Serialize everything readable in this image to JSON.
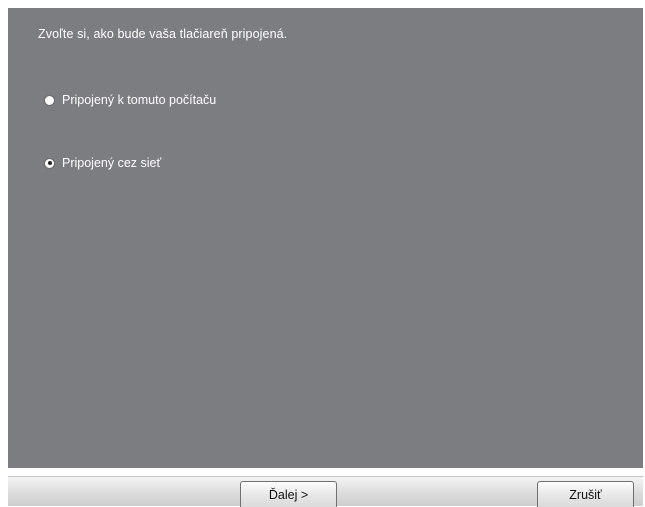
{
  "main": {
    "prompt": "Zvoľte si, ako bude vaša tlačiareň pripojená.",
    "options": [
      {
        "label": "Pripojený k tomuto počítaču",
        "selected": false
      },
      {
        "label": "Pripojený cez sieť",
        "selected": true
      }
    ]
  },
  "footer": {
    "next_label": "Ďalej >",
    "cancel_label": "Zrušiť"
  },
  "colors": {
    "panel_background": "#7c7d81",
    "text": "#ffffff"
  }
}
